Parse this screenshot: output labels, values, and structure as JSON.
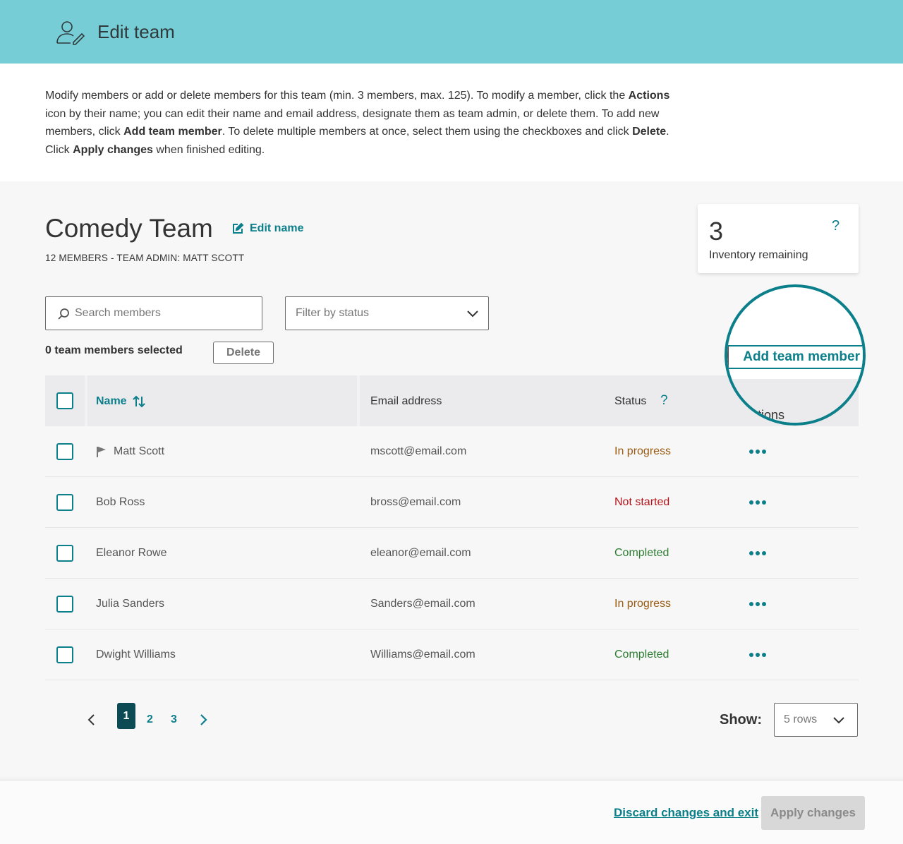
{
  "header": {
    "title": "Edit team",
    "icon": "user-edit-icon"
  },
  "intro": {
    "p1": "Modify members or add or delete members for this team (min. 3 members, max. 125). To modify a member, click the ",
    "b1": "Actions",
    "p2": " icon by their name; you can edit their name and email address, designate them as team admin, or delete them. To add new members, click ",
    "b2": "Add team member",
    "p3": ". To delete multiple members at once, select them using the checkboxes and click ",
    "b3": "Delete",
    "p4": ". Click ",
    "b4": "Apply changes",
    "p5": " when finished editing."
  },
  "team": {
    "name": "Comedy Team",
    "edit_name_label": "Edit name",
    "meta": "12 MEMBERS - TEAM ADMIN: MATT SCOTT"
  },
  "inventory": {
    "count": "3",
    "label": "Inventory remaining",
    "help": "?"
  },
  "search": {
    "placeholder": "Search members",
    "value": ""
  },
  "filter": {
    "placeholder": "Filter by status"
  },
  "selection": {
    "text": "0 team members selected",
    "delete_label": "Delete"
  },
  "add_member_label": "Add team member",
  "table": {
    "headers": {
      "name": "Name",
      "email": "Email address",
      "status": "Status",
      "status_help": "?",
      "actions": "Actions"
    },
    "rows": [
      {
        "name": "Matt Scott",
        "email": "mscott@email.com",
        "status": "In progress",
        "admin": true
      },
      {
        "name": "Bob Ross",
        "email": "bross@email.com",
        "status": "Not started",
        "admin": false
      },
      {
        "name": "Eleanor Rowe",
        "email": "eleanor@email.com",
        "status": "Completed",
        "admin": false
      },
      {
        "name": "Julia Sanders",
        "email": "Sanders@email.com",
        "status": "In progress",
        "admin": false
      },
      {
        "name": "Dwight Williams",
        "email": "Williams@email.com",
        "status": "Completed",
        "admin": false
      }
    ]
  },
  "status_colors": {
    "In progress": "#9a5b13",
    "Not started": "#b8141b",
    "Completed": "#2e7d32"
  },
  "pagination": {
    "pages": [
      "1",
      "2",
      "3"
    ],
    "current": "1"
  },
  "rows_per_page": {
    "label": "Show:",
    "value": "5 rows"
  },
  "footer": {
    "discard_label": "Discard changes and exit",
    "apply_label": "Apply changes"
  },
  "colors": {
    "header_bg": "#77cdd5",
    "accent": "#0b7f8a",
    "active_page": "#0c4a54"
  }
}
